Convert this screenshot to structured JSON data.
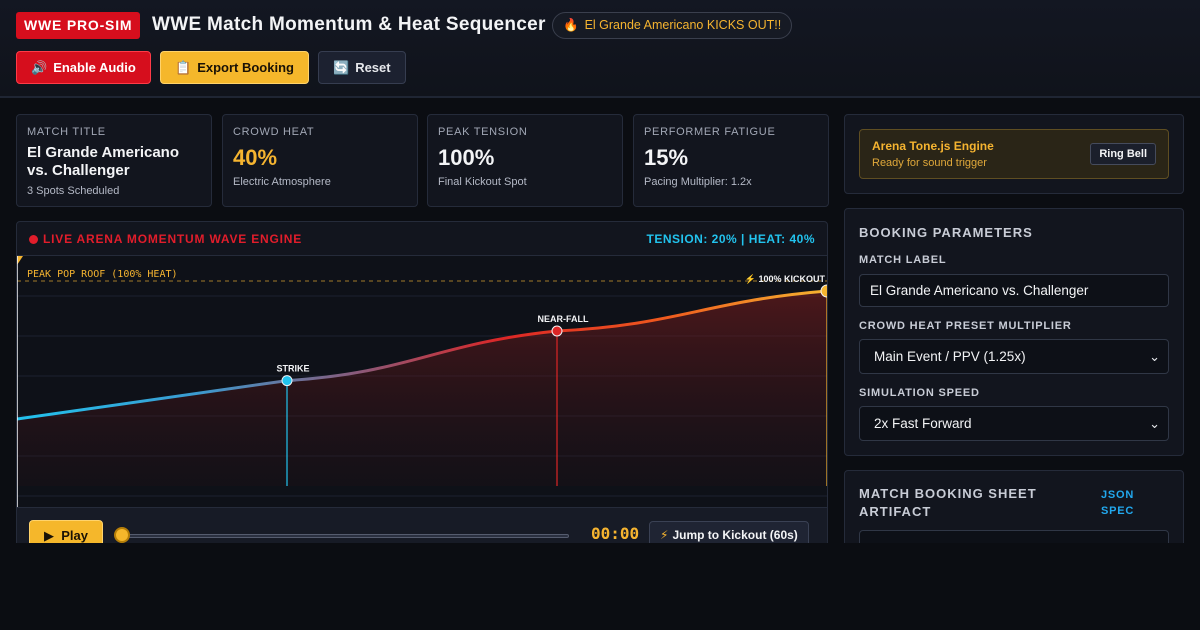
{
  "header": {
    "brand": "WWE PRO-SIM",
    "title": "WWE Match Momentum & Heat Sequencer",
    "status_icon": "fire-icon",
    "status_text": "El Grande Americano KICKS OUT!!"
  },
  "toolbar": {
    "audio_label": "Enable Audio",
    "audio_icon": "speaker-icon",
    "export_label": "Export Booking",
    "export_icon": "clipboard-icon",
    "reset_label": "Reset",
    "reset_icon": "refresh-icon"
  },
  "stats": [
    {
      "label": "MATCH TITLE",
      "value": "El Grande Americano vs. Challenger",
      "sub": "3 Spots Scheduled"
    },
    {
      "label": "CROWD HEAT",
      "value": "40%",
      "sub": "Electric Atmosphere"
    },
    {
      "label": "PEAK TENSION",
      "value": "100%",
      "sub": "Final Kickout Spot"
    },
    {
      "label": "PERFORMER FATIGUE",
      "value": "15%",
      "sub": "Pacing Multiplier: 1.2x"
    }
  ],
  "wave": {
    "title": "LIVE ARENA MOMENTUM WAVE ENGINE",
    "readout": "TENSION: 20% | HEAT: 40%",
    "roof_label": "PEAK POP ROOF (100% HEAT)",
    "play_label": "Play",
    "timer": "00:00",
    "jump_label": "Jump to Kickout (60s)",
    "progress": 0
  },
  "chart_data": {
    "type": "line",
    "x": [
      0,
      20,
      40,
      60
    ],
    "y": [
      20,
      44,
      75,
      100
    ],
    "spots": [
      {
        "label": "STRIKE",
        "x": 20,
        "y": 44
      },
      {
        "label": "NEAR-FALL",
        "x": 40,
        "y": 75
      },
      {
        "label": "⚡ 100% KICKOUT",
        "x": 60,
        "y": 100
      }
    ],
    "xlim": [
      0,
      60
    ],
    "ylim": [
      0,
      100
    ],
    "colors": {
      "low": "#22c3ee",
      "mid": "#dc2626",
      "high": "#f5b430"
    }
  },
  "engine": {
    "title": "Arena Tone.js Engine",
    "sub": "Ready for sound trigger",
    "ring_label": "Ring Bell"
  },
  "params": {
    "title": "BOOKING PARAMETERS",
    "match_label_title": "MATCH LABEL",
    "match_label_value": "El Grande Americano vs. Challenger",
    "heat_title": "CROWD HEAT PRESET MULTIPLIER",
    "heat_value": "Main Event / PPV (1.25x)",
    "speed_title": "SIMULATION SPEED",
    "speed_value": "2x Fast Forward"
  },
  "artifact": {
    "title": "MATCH BOOKING SHEET ARTIFACT",
    "link": "JSON SPEC"
  }
}
